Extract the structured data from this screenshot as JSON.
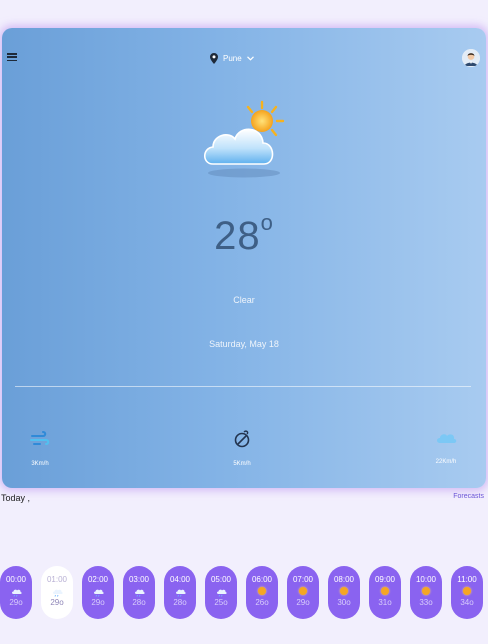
{
  "header": {
    "location": "Pune",
    "icons": {
      "menu": "menu-icon",
      "pin": "location-pin-icon",
      "dropdown": "chevron-down-icon",
      "avatar": "user-avatar-icon"
    }
  },
  "current": {
    "icon": "partly-cloudy-icon",
    "temperature": "28",
    "degree_symbol": "o",
    "condition": "Clear",
    "date": "Saturday, May 18"
  },
  "stats": [
    {
      "icon": "wind-icon",
      "value": "3Km/h"
    },
    {
      "icon": "wind-gauge-icon",
      "value": "5Km/h"
    },
    {
      "icon": "cloud-icon",
      "value": "22Km/h"
    }
  ],
  "today": {
    "label": "Today ,",
    "forecasts_link": "Forecasts"
  },
  "hourly": [
    {
      "time": "00:00",
      "temp": "29o",
      "icon": "cloud-rain-icon",
      "active": false
    },
    {
      "time": "01:00",
      "temp": "29o",
      "icon": "cloud-rain-icon",
      "active": true
    },
    {
      "time": "02:00",
      "temp": "29o",
      "icon": "cloud-rain-icon",
      "active": false
    },
    {
      "time": "03:00",
      "temp": "28o",
      "icon": "cloud-rain-icon",
      "active": false
    },
    {
      "time": "04:00",
      "temp": "28o",
      "icon": "cloud-rain-icon",
      "active": false
    },
    {
      "time": "05:00",
      "temp": "25o",
      "icon": "cloud-rain-icon",
      "active": false
    },
    {
      "time": "06:00",
      "temp": "26o",
      "icon": "sun-icon",
      "active": false
    },
    {
      "time": "07:00",
      "temp": "29o",
      "icon": "sun-icon",
      "active": false
    },
    {
      "time": "08:00",
      "temp": "30o",
      "icon": "sun-icon",
      "active": false
    },
    {
      "time": "09:00",
      "temp": "31o",
      "icon": "sun-icon",
      "active": false
    },
    {
      "time": "10:00",
      "temp": "33o",
      "icon": "sun-icon",
      "active": false
    },
    {
      "time": "11:00",
      "temp": "34o",
      "icon": "sun-icon",
      "active": false
    }
  ],
  "colors": {
    "card_gradient_start": "#6a9fd8",
    "card_gradient_end": "#a8cbf0",
    "hour_pill": "#8a63f0",
    "hour_pill_active": "#ffffff",
    "accent_link": "#6a54d6"
  }
}
